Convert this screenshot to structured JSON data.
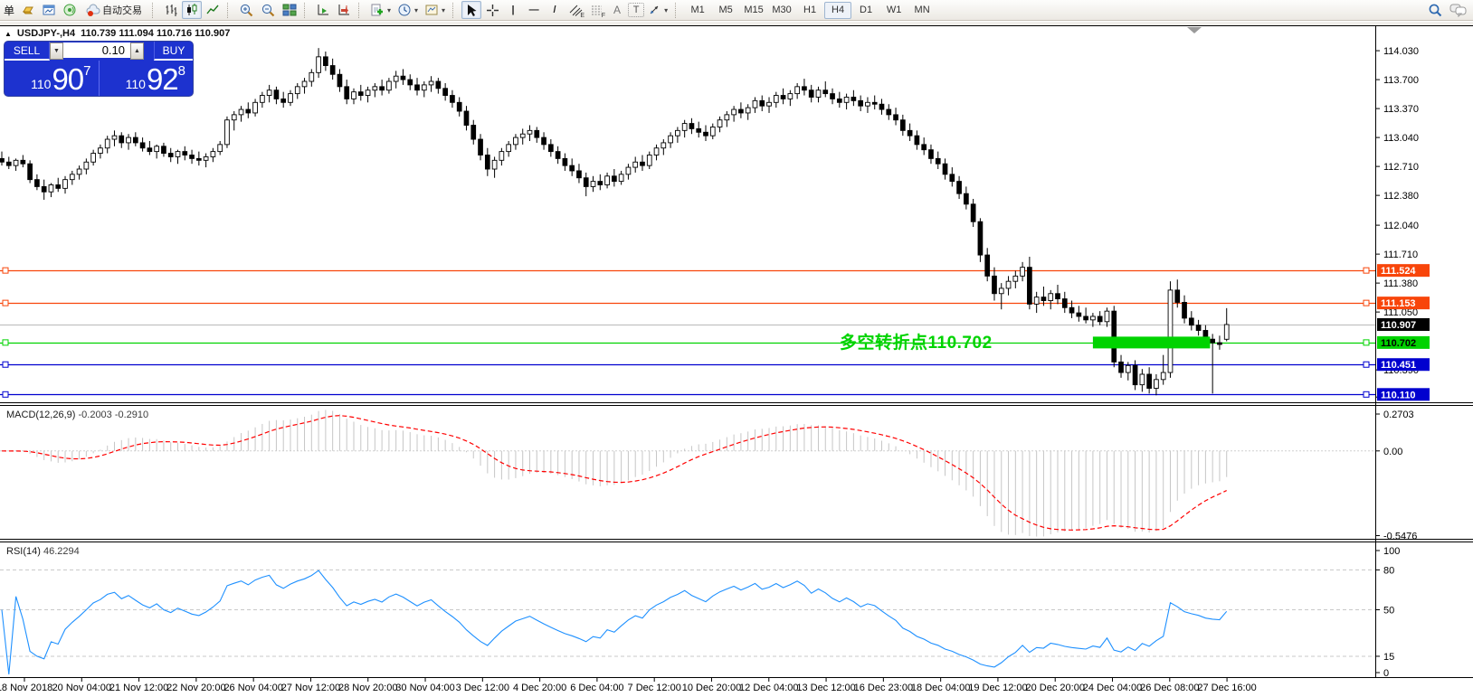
{
  "toolbar": {
    "new_order_label": "单",
    "autotrading_label": "自动交易",
    "timeframes": [
      "M1",
      "M5",
      "M15",
      "M30",
      "H1",
      "H4",
      "D1",
      "W1",
      "MN"
    ],
    "active_timeframe": "H4",
    "glyphs": {
      "dropdown": "▾",
      "vertical_line": "|",
      "horizontal_line": "—",
      "trendline": "/",
      "channel_letter": "E",
      "fibo_letter": "F",
      "text_tool": "A",
      "label_tool": "T"
    }
  },
  "ohlc_title": {
    "expander": "▲",
    "symbol": "USDJPY-,H4",
    "values": "110.739 111.094 110.716 110.907"
  },
  "trade_panel": {
    "sell_label": "SELL",
    "buy_label": "BUY",
    "volume": "0.10",
    "spin_down": "▼",
    "spin_up": "▲",
    "sell_price_small": "110",
    "sell_price_big": "90",
    "sell_price_sup": "7",
    "buy_price_small": "110",
    "buy_price_big": "92",
    "buy_price_sup": "8"
  },
  "indicators": {
    "macd": {
      "label": "MACD(12,26,9)",
      "values": "-0.2003 -0.2910"
    },
    "rsi": {
      "label": "RSI(14)",
      "value": "46.2294"
    }
  },
  "chart_data": {
    "type": "candlestick",
    "symbol": "USDJPY-",
    "period": "H4",
    "last_ohlc": {
      "open": 110.739,
      "high": 111.094,
      "low": 110.716,
      "close": 110.907
    },
    "y_axis": {
      "ticks": [
        "114.030",
        "113.700",
        "113.370",
        "113.040",
        "112.710",
        "112.380",
        "112.040",
        "111.710",
        "111.380",
        "111.050",
        "110.390",
        "110.080"
      ]
    },
    "x_axis": {
      "labels": [
        "18 Nov 2018",
        "20 Nov 04:00",
        "21 Nov 12:00",
        "22 Nov 20:00",
        "26 Nov 04:00",
        "27 Nov 12:00",
        "28 Nov 20:00",
        "30 Nov 04:00",
        "3 Dec 12:00",
        "4 Dec 20:00",
        "6 Dec 04:00",
        "7 Dec 12:00",
        "10 Dec 20:00",
        "12 Dec 04:00",
        "13 Dec 12:00",
        "16 Dec 23:00",
        "18 Dec 04:00",
        "19 Dec 12:00",
        "20 Dec 20:00",
        "24 Dec 04:00",
        "26 Dec 08:00",
        "27 Dec 16:00"
      ]
    },
    "price_lines": [
      {
        "price": 111.524,
        "label": "111.524",
        "color": "#f8450a",
        "label_bg": "#f8450a",
        "text_color": "#ffffff",
        "style": "level"
      },
      {
        "price": 111.153,
        "label": "111.153",
        "color": "#f8450a",
        "label_bg": "#f8450a",
        "text_color": "#ffffff",
        "style": "level"
      },
      {
        "price": 110.907,
        "label": "110.907",
        "color": "#b9b9b9",
        "label_bg": "#000000",
        "text_color": "#ffffff",
        "style": "current"
      },
      {
        "price": 110.702,
        "label": "110.702",
        "color": "#00d300",
        "label_bg": "#00d300",
        "text_color": "#000000",
        "style": "level"
      },
      {
        "price": 110.451,
        "label": "110.451",
        "color": "#0000cf",
        "label_bg": "#0000cf",
        "text_color": "#ffffff",
        "style": "level"
      },
      {
        "price": 110.11,
        "label": "110.110",
        "color": "#0000cf",
        "label_bg": "#0000cf",
        "text_color": "#ffffff",
        "style": "level"
      }
    ],
    "highlight_zone": {
      "price": 110.702,
      "x_start_bar": 155,
      "x_end_bar": 171,
      "color": "#00d300"
    },
    "annotation": {
      "text": "多空转折点110.702",
      "color": "#00d300"
    },
    "macd": {
      "params": [
        12,
        26,
        9
      ],
      "value": -0.2003,
      "signal_value": -0.291,
      "y_ticks": [
        "0.2703",
        "0.00",
        "-0.5476"
      ],
      "histogram_color": "#c6c6c6",
      "signal_color": "#ff0000"
    },
    "rsi": {
      "period": 14,
      "value": 46.2294,
      "y_ticks": [
        "100",
        "80",
        "50",
        "15",
        "0"
      ],
      "levels": [
        80,
        50,
        15
      ],
      "color": "#1e90ff"
    },
    "candles": [
      [
        112.8,
        112.88,
        112.72,
        112.76
      ],
      [
        112.76,
        112.82,
        112.68,
        112.72
      ],
      [
        112.72,
        112.8,
        112.66,
        112.78
      ],
      [
        112.78,
        112.84,
        112.7,
        112.74
      ],
      [
        112.74,
        112.78,
        112.52,
        112.56
      ],
      [
        112.56,
        112.62,
        112.44,
        112.48
      ],
      [
        112.48,
        112.56,
        112.33,
        112.42
      ],
      [
        112.42,
        112.52,
        112.36,
        112.5
      ],
      [
        112.5,
        112.58,
        112.42,
        112.46
      ],
      [
        112.46,
        112.6,
        112.4,
        112.56
      ],
      [
        112.56,
        112.66,
        112.5,
        112.62
      ],
      [
        112.62,
        112.72,
        112.56,
        112.68
      ],
      [
        112.68,
        112.8,
        112.62,
        112.76
      ],
      [
        112.76,
        112.9,
        112.72,
        112.86
      ],
      [
        112.86,
        112.96,
        112.8,
        112.92
      ],
      [
        112.92,
        113.06,
        112.86,
        113.02
      ],
      [
        113.02,
        113.12,
        112.94,
        113.06
      ],
      [
        113.06,
        113.1,
        112.92,
        112.98
      ],
      [
        112.98,
        113.08,
        112.9,
        113.04
      ],
      [
        113.04,
        113.1,
        112.94,
        112.98
      ],
      [
        112.98,
        113.04,
        112.88,
        112.92
      ],
      [
        112.92,
        113.0,
        112.84,
        112.88
      ],
      [
        112.88,
        112.96,
        112.8,
        112.94
      ],
      [
        112.94,
        112.98,
        112.82,
        112.86
      ],
      [
        112.86,
        112.92,
        112.76,
        112.82
      ],
      [
        112.82,
        112.9,
        112.74,
        112.88
      ],
      [
        112.88,
        112.94,
        112.78,
        112.84
      ],
      [
        112.84,
        112.9,
        112.74,
        112.8
      ],
      [
        112.8,
        112.88,
        112.72,
        112.78
      ],
      [
        112.78,
        112.86,
        112.7,
        112.82
      ],
      [
        112.82,
        112.92,
        112.76,
        112.88
      ],
      [
        112.88,
        113.0,
        112.84,
        112.96
      ],
      [
        112.96,
        113.28,
        112.92,
        113.24
      ],
      [
        113.24,
        113.34,
        113.12,
        113.3
      ],
      [
        113.3,
        113.4,
        113.22,
        113.36
      ],
      [
        113.36,
        113.44,
        113.26,
        113.32
      ],
      [
        113.32,
        113.48,
        113.28,
        113.44
      ],
      [
        113.44,
        113.56,
        113.38,
        113.52
      ],
      [
        113.52,
        113.64,
        113.44,
        113.58
      ],
      [
        113.58,
        113.62,
        113.42,
        113.48
      ],
      [
        113.48,
        113.56,
        113.38,
        113.44
      ],
      [
        113.44,
        113.58,
        113.4,
        113.54
      ],
      [
        113.54,
        113.66,
        113.48,
        113.62
      ],
      [
        113.62,
        113.72,
        113.54,
        113.68
      ],
      [
        113.68,
        113.82,
        113.62,
        113.78
      ],
      [
        113.78,
        114.06,
        113.72,
        113.96
      ],
      [
        113.96,
        114.02,
        113.8,
        113.86
      ],
      [
        113.86,
        113.94,
        113.7,
        113.76
      ],
      [
        113.76,
        113.82,
        113.56,
        113.62
      ],
      [
        113.62,
        113.7,
        113.42,
        113.48
      ],
      [
        113.48,
        113.6,
        113.42,
        113.56
      ],
      [
        113.56,
        113.64,
        113.46,
        113.52
      ],
      [
        113.52,
        113.62,
        113.44,
        113.58
      ],
      [
        113.58,
        113.66,
        113.5,
        113.62
      ],
      [
        113.62,
        113.7,
        113.52,
        113.58
      ],
      [
        113.58,
        113.72,
        113.54,
        113.68
      ],
      [
        113.68,
        113.8,
        113.6,
        113.74
      ],
      [
        113.74,
        113.82,
        113.64,
        113.7
      ],
      [
        113.7,
        113.76,
        113.58,
        113.64
      ],
      [
        113.64,
        113.72,
        113.52,
        113.58
      ],
      [
        113.58,
        113.68,
        113.5,
        113.64
      ],
      [
        113.64,
        113.74,
        113.56,
        113.68
      ],
      [
        113.68,
        113.72,
        113.54,
        113.6
      ],
      [
        113.6,
        113.66,
        113.46,
        113.52
      ],
      [
        113.52,
        113.58,
        113.38,
        113.44
      ],
      [
        113.44,
        113.5,
        113.28,
        113.34
      ],
      [
        113.34,
        113.4,
        113.12,
        113.18
      ],
      [
        113.18,
        113.24,
        112.96,
        113.02
      ],
      [
        113.02,
        113.08,
        112.78,
        112.84
      ],
      [
        112.84,
        112.92,
        112.6,
        112.68
      ],
      [
        112.68,
        112.82,
        112.58,
        112.78
      ],
      [
        112.78,
        112.92,
        112.72,
        112.88
      ],
      [
        112.88,
        113.0,
        112.82,
        112.96
      ],
      [
        112.96,
        113.08,
        112.9,
        113.04
      ],
      [
        113.04,
        113.14,
        112.96,
        113.08
      ],
      [
        113.08,
        113.18,
        113.0,
        113.12
      ],
      [
        113.12,
        113.16,
        112.98,
        113.04
      ],
      [
        113.04,
        113.1,
        112.9,
        112.96
      ],
      [
        112.96,
        113.02,
        112.82,
        112.88
      ],
      [
        112.88,
        112.94,
        112.74,
        112.8
      ],
      [
        112.8,
        112.86,
        112.66,
        112.72
      ],
      [
        112.72,
        112.8,
        112.6,
        112.66
      ],
      [
        112.66,
        112.74,
        112.52,
        112.58
      ],
      [
        112.58,
        112.64,
        112.37,
        112.48
      ],
      [
        112.48,
        112.6,
        112.42,
        112.54
      ],
      [
        112.54,
        112.62,
        112.44,
        112.5
      ],
      [
        112.5,
        112.64,
        112.46,
        112.6
      ],
      [
        112.6,
        112.68,
        112.48,
        112.54
      ],
      [
        112.54,
        112.66,
        112.5,
        112.62
      ],
      [
        112.62,
        112.74,
        112.56,
        112.7
      ],
      [
        112.7,
        112.82,
        112.64,
        112.76
      ],
      [
        112.76,
        112.84,
        112.66,
        112.72
      ],
      [
        112.72,
        112.88,
        112.68,
        112.84
      ],
      [
        112.84,
        112.96,
        112.78,
        112.92
      ],
      [
        112.92,
        113.02,
        112.84,
        112.98
      ],
      [
        112.98,
        113.1,
        112.92,
        113.06
      ],
      [
        113.06,
        113.16,
        112.98,
        113.12
      ],
      [
        113.12,
        113.24,
        113.04,
        113.2
      ],
      [
        113.2,
        113.26,
        113.08,
        113.14
      ],
      [
        113.14,
        113.22,
        113.04,
        113.1
      ],
      [
        113.1,
        113.18,
        113.0,
        113.06
      ],
      [
        113.06,
        113.2,
        113.02,
        113.16
      ],
      [
        113.16,
        113.28,
        113.1,
        113.24
      ],
      [
        113.24,
        113.34,
        113.16,
        113.3
      ],
      [
        113.3,
        113.4,
        113.22,
        113.36
      ],
      [
        113.36,
        113.44,
        113.26,
        113.32
      ],
      [
        113.32,
        113.42,
        113.24,
        113.38
      ],
      [
        113.38,
        113.5,
        113.32,
        113.46
      ],
      [
        113.46,
        113.52,
        113.34,
        113.4
      ],
      [
        113.4,
        113.5,
        113.32,
        113.44
      ],
      [
        113.44,
        113.56,
        113.38,
        113.52
      ],
      [
        113.52,
        113.6,
        113.42,
        113.48
      ],
      [
        113.48,
        113.58,
        113.4,
        113.54
      ],
      [
        113.54,
        113.66,
        113.48,
        113.62
      ],
      [
        113.62,
        113.71,
        113.52,
        113.58
      ],
      [
        113.58,
        113.64,
        113.44,
        113.5
      ],
      [
        113.5,
        113.62,
        113.44,
        113.58
      ],
      [
        113.58,
        113.68,
        113.5,
        113.54
      ],
      [
        113.54,
        113.6,
        113.42,
        113.48
      ],
      [
        113.48,
        113.56,
        113.38,
        113.44
      ],
      [
        113.44,
        113.54,
        113.36,
        113.5
      ],
      [
        113.5,
        113.58,
        113.4,
        113.46
      ],
      [
        113.46,
        113.52,
        113.34,
        113.4
      ],
      [
        113.4,
        113.5,
        113.32,
        113.44
      ],
      [
        113.44,
        113.52,
        113.36,
        113.42
      ],
      [
        113.42,
        113.48,
        113.3,
        113.36
      ],
      [
        113.36,
        113.42,
        113.24,
        113.3
      ],
      [
        113.3,
        113.38,
        113.18,
        113.24
      ],
      [
        113.24,
        113.3,
        113.06,
        113.12
      ],
      [
        113.12,
        113.2,
        113.0,
        113.06
      ],
      [
        113.06,
        113.12,
        112.9,
        112.96
      ],
      [
        112.96,
        113.04,
        112.84,
        112.9
      ],
      [
        112.9,
        112.96,
        112.74,
        112.8
      ],
      [
        112.8,
        112.88,
        112.68,
        112.74
      ],
      [
        112.74,
        112.8,
        112.56,
        112.62
      ],
      [
        112.62,
        112.7,
        112.48,
        112.54
      ],
      [
        112.54,
        112.6,
        112.34,
        112.4
      ],
      [
        112.4,
        112.48,
        112.22,
        112.28
      ],
      [
        112.28,
        112.34,
        112.02,
        112.08
      ],
      [
        112.08,
        112.12,
        111.62,
        111.7
      ],
      [
        111.7,
        111.78,
        111.4,
        111.46
      ],
      [
        111.46,
        111.56,
        111.18,
        111.26
      ],
      [
        111.26,
        111.38,
        111.08,
        111.32
      ],
      [
        111.32,
        111.46,
        111.24,
        111.4
      ],
      [
        111.4,
        111.52,
        111.32,
        111.46
      ],
      [
        111.46,
        111.62,
        111.4,
        111.56
      ],
      [
        111.56,
        111.68,
        111.08,
        111.14
      ],
      [
        111.14,
        111.28,
        111.04,
        111.22
      ],
      [
        111.22,
        111.34,
        111.12,
        111.18
      ],
      [
        111.18,
        111.3,
        111.08,
        111.26
      ],
      [
        111.26,
        111.36,
        111.14,
        111.2
      ],
      [
        111.2,
        111.28,
        111.04,
        111.1
      ],
      [
        111.1,
        111.18,
        110.98,
        111.04
      ],
      [
        111.04,
        111.12,
        110.94,
        111.0
      ],
      [
        111.0,
        111.1,
        110.92,
        110.96
      ],
      [
        110.96,
        111.04,
        110.88,
        111.0
      ],
      [
        111.0,
        111.06,
        110.9,
        110.94
      ],
      [
        110.94,
        111.1,
        110.88,
        111.06
      ],
      [
        111.06,
        111.12,
        110.42,
        110.48
      ],
      [
        110.48,
        110.56,
        110.3,
        110.36
      ],
      [
        110.36,
        110.48,
        110.27,
        110.44
      ],
      [
        110.44,
        110.5,
        110.16,
        110.22
      ],
      [
        110.22,
        110.4,
        110.14,
        110.34
      ],
      [
        110.34,
        110.42,
        110.12,
        110.18
      ],
      [
        110.18,
        110.34,
        110.1,
        110.28
      ],
      [
        110.28,
        110.56,
        110.22,
        110.36
      ],
      [
        110.36,
        111.4,
        110.3,
        111.3
      ],
      [
        111.3,
        111.42,
        111.1,
        111.16
      ],
      [
        111.16,
        111.24,
        110.92,
        110.98
      ],
      [
        110.98,
        111.06,
        110.84,
        110.9
      ],
      [
        110.9,
        110.96,
        110.78,
        110.84
      ],
      [
        110.84,
        110.9,
        110.68,
        110.74
      ],
      [
        110.74,
        110.8,
        110.12,
        110.7
      ],
      [
        110.7,
        110.78,
        110.62,
        110.68
      ],
      [
        110.739,
        111.094,
        110.716,
        110.907
      ]
    ]
  }
}
